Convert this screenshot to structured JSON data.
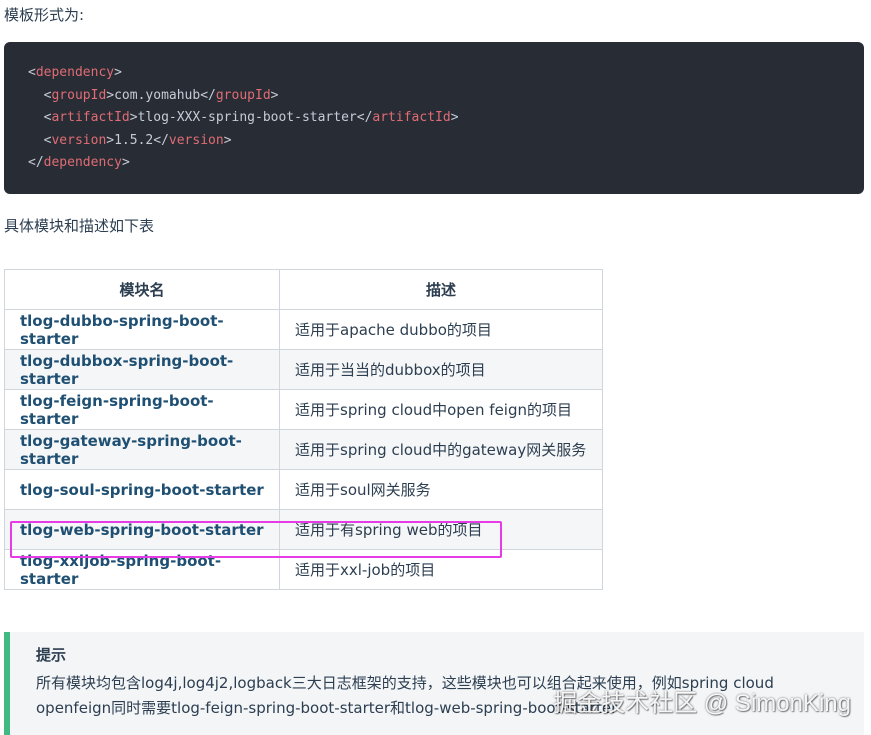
{
  "intro_text": "模板形式为:",
  "code": {
    "lines": [
      {
        "open": "dependency",
        "value": "",
        "close": ""
      },
      {
        "open": "groupId",
        "value": "com.yomahub",
        "close": "groupId"
      },
      {
        "open": "artifactId",
        "value": "tlog-XXX-spring-boot-starter",
        "close": "artifactId"
      },
      {
        "open": "version",
        "value": "1.5.2",
        "close": "version"
      },
      {
        "open": "",
        "value": "",
        "close": "dependency"
      }
    ]
  },
  "table_caption": "具体模块和描述如下表",
  "table": {
    "headers": [
      "模块名",
      "描述"
    ],
    "rows": [
      [
        "tlog-dubbo-spring-boot-starter",
        "适用于apache dubbo的项目"
      ],
      [
        "tlog-dubbox-spring-boot-starter",
        "适用于当当的dubbox的项目"
      ],
      [
        "tlog-feign-spring-boot-starter",
        "适用于spring cloud中open feign的项目"
      ],
      [
        "tlog-gateway-spring-boot-starter",
        "适用于spring cloud中的gateway网关服务"
      ],
      [
        "tlog-soul-spring-boot-starter",
        "适用于soul网关服务"
      ],
      [
        "tlog-web-spring-boot-starter",
        "适用于有spring web的项目"
      ],
      [
        "tlog-xxljob-spring-boot-starter",
        "适用于xxl-job的项目"
      ]
    ]
  },
  "tip": {
    "title": "提示",
    "body": "所有模块均包含log4j,log4j2,logback三大日志框架的支持，这些模块也可以组合起来使用，例如spring cloud openfeign同时需要tlog-feign-spring-boot-starter和tlog-web-spring-boot-starter"
  },
  "watermark": "掘金技术社区 @ SimonKing"
}
